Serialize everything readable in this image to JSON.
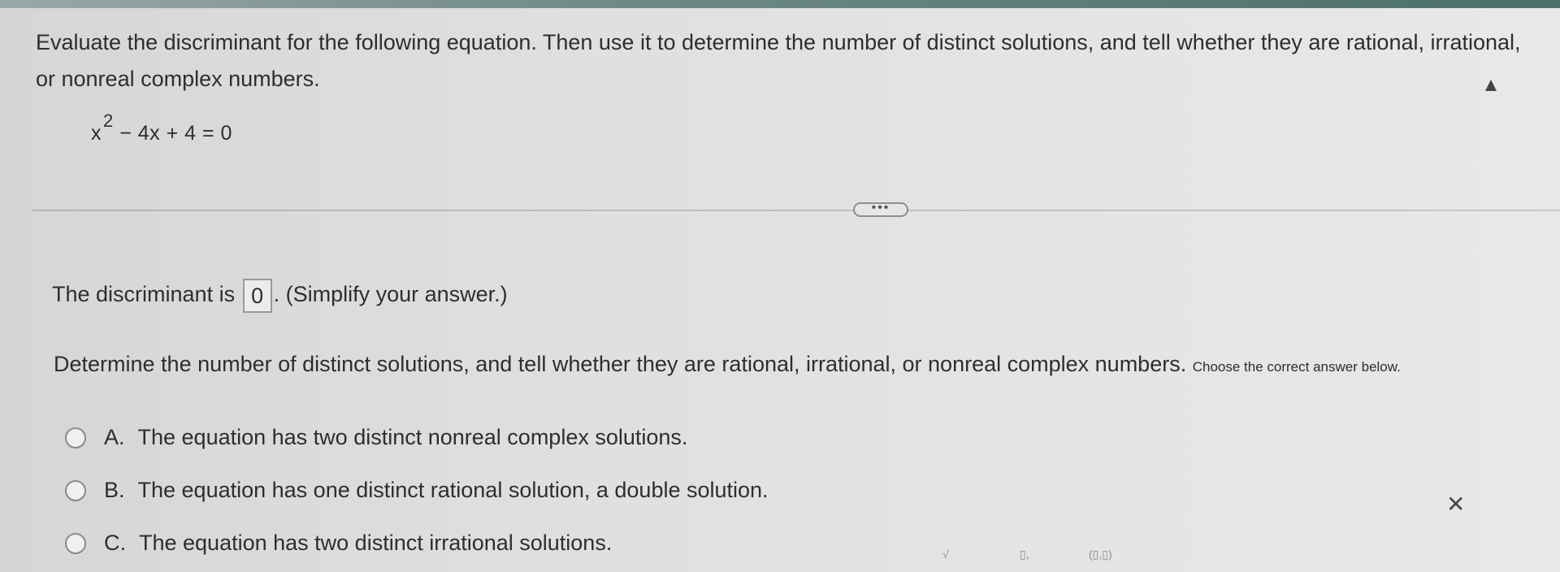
{
  "question": {
    "text": "Evaluate the discriminant for the following equation. Then use it to determine the number of distinct solutions, and tell whether they are rational, irrational, or nonreal complex numbers."
  },
  "equation": {
    "base": "x",
    "exponent": "2",
    "rest": " − 4x + 4 = 0"
  },
  "more_button": {
    "label": "•••"
  },
  "discriminant": {
    "prefix": "The discriminant is",
    "value": "0",
    "suffix": ". (Simplify your answer.)"
  },
  "determine": {
    "text": "Determine the number of distinct solutions, and tell whether they are rational, irrational, or nonreal complex numbers.",
    "tail": "Choose the correct answer below."
  },
  "options": [
    {
      "letter": "A.",
      "text": "The equation has two distinct nonreal complex solutions."
    },
    {
      "letter": "B.",
      "text": "The equation has one distinct rational solution, a double solution."
    },
    {
      "letter": "C.",
      "text": "The equation has two distinct irrational solutions."
    }
  ],
  "toolbar": {
    "sqrt_symbol": "√",
    "subscript_symbol": "▯,",
    "interval_symbol": "(▯,▯)"
  },
  "icons": {
    "close": "close-icon",
    "cursor": "cursor-icon"
  }
}
